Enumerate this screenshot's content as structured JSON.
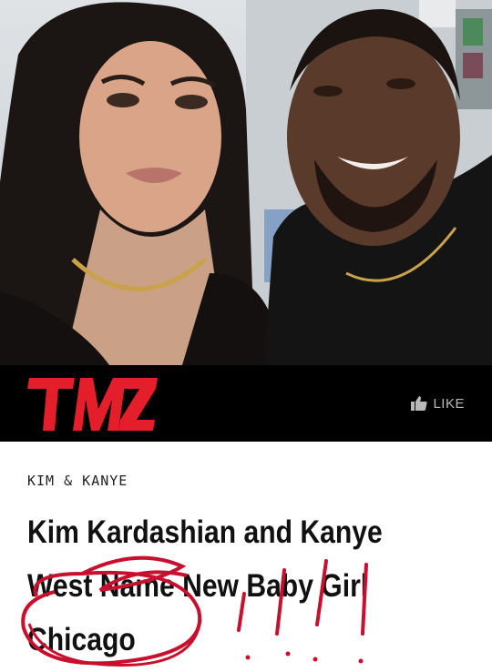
{
  "brand": {
    "logo_text": "TMZ",
    "logo_color": "#e41e2b",
    "like_label": "LIKE"
  },
  "article": {
    "category": "KIM & KANYE",
    "headline_lines": [
      "Kim Kardashian and Kanye",
      "West Name New Baby Girl",
      "Chicago"
    ]
  },
  "colors": {
    "bar_background": "#000000",
    "annotation_red": "#c8102e"
  }
}
